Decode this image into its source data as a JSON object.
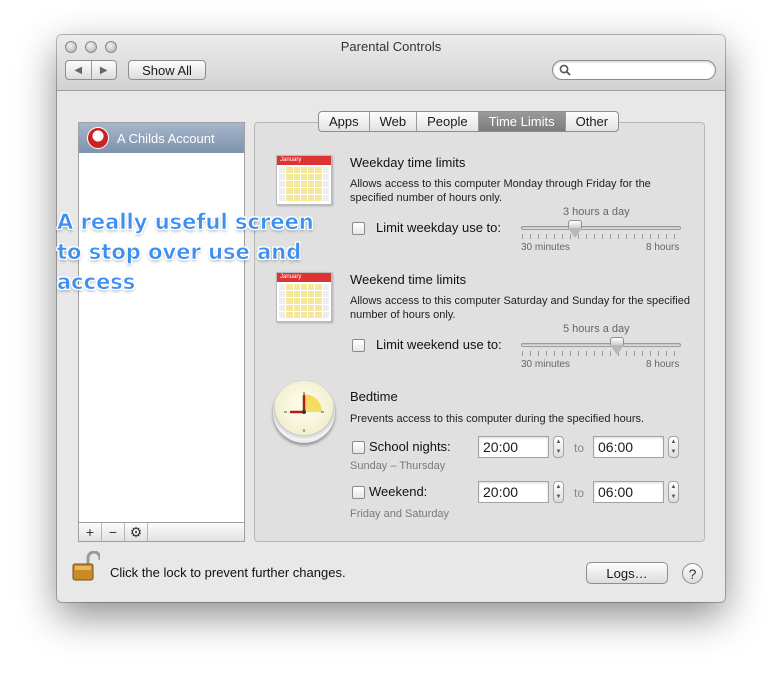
{
  "window": {
    "title": "Parental Controls"
  },
  "toolbar": {
    "back_icon": "back-arrow-icon",
    "forward_icon": "forward-arrow-icon",
    "show_all_label": "Show All",
    "search_placeholder": ""
  },
  "sidebar": {
    "accounts": [
      {
        "name": "A Childs Account",
        "icon": "child-avatar-icon"
      }
    ],
    "buttons": [
      "+",
      "−",
      "⚙"
    ]
  },
  "tabs": [
    {
      "label": "Apps",
      "selected": false
    },
    {
      "label": "Web",
      "selected": false
    },
    {
      "label": "People",
      "selected": false
    },
    {
      "label": "Time Limits",
      "selected": true
    },
    {
      "label": "Other",
      "selected": false
    }
  ],
  "weekday": {
    "calendar_month": "January",
    "title": "Weekday time limits",
    "description": "Allows access to this computer Monday through Friday for the specified number of hours only.",
    "checkbox_label": "Limit weekday use to:",
    "checked": false,
    "value_label": "3 hours a day",
    "min_label": "30 minutes",
    "max_label": "8 hours",
    "slider_value_hours": 3
  },
  "weekend": {
    "calendar_month": "January",
    "title": "Weekend time limits",
    "description": "Allows access to this computer Saturday and Sunday for the specified number of hours only.",
    "checkbox_label": "Limit weekend use to:",
    "checked": false,
    "value_label": "5 hours a day",
    "min_label": "30 minutes",
    "max_label": "8 hours",
    "slider_value_hours": 5
  },
  "bedtime": {
    "title": "Bedtime",
    "description": "Prevents access to this computer during the specified hours.",
    "school_nights": {
      "label": "School nights:",
      "from": "20:00",
      "to_word": "to",
      "to": "06:00",
      "sub": "Sunday – Thursday",
      "checked": false
    },
    "weekend": {
      "label": "Weekend:",
      "from": "20:00",
      "to_word": "to",
      "to": "06:00",
      "sub": "Friday and Saturday",
      "checked": false
    }
  },
  "footer": {
    "lock_text": "Click the lock to prevent further changes.",
    "logs_label": "Logs…",
    "help_label": "?"
  },
  "annotation": {
    "text": "A really useful screen\nto stop over use and\naccess",
    "color": "#3d8ff0"
  }
}
